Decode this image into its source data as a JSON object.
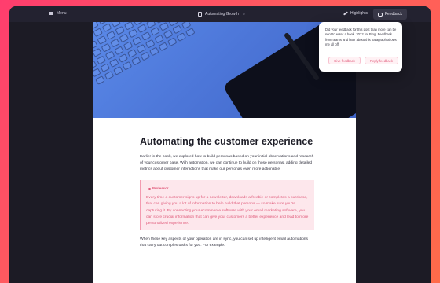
{
  "colors": {
    "background_gradient": [
      "#ff3d6e",
      "#ff6b4a"
    ],
    "window_bg": "#1c1b25",
    "page_bg": "#ffffff",
    "highlight_pink": "#e05a7a"
  },
  "titlebar": {
    "menu_label": "Menu",
    "doc_title": "Automating Growth",
    "highlights_label": "Highlights",
    "feedback_label": "Feedback"
  },
  "hero": {
    "image_alt": "Keyboard and tablet"
  },
  "article": {
    "heading": "Automating the customer experience",
    "intro": "Earlier in the book, we explored how to build personas based on your initial observations and research of your customer base. With automation, we can continue to build on those personas, adding detailed metrics about customer interactions that make our personas even more actionable.",
    "highlight_tag": "Professor",
    "highlight_text": "Every time a customer signs up for a newsletter, downloads a freebie or completes a purchase, that can giving you a lot of information to help build that persona — so make sure you're capturing it. By connecting your ecommerce software with your email marketing software, you can store crucial information that can give your customers a better experience and lead to more personalized experience.",
    "closing": "When these key aspects of your operation are in sync, you can set up intelligent email automations that carry out complex tasks for you. For example:"
  },
  "popup": {
    "text": "Did your feedback for this post than more can be sent to enter a book. 2022 for Blog. Feedback from teams and later about this paragraph allows me all off.",
    "button_left": "Give feedback",
    "button_right": "Reply feedback"
  }
}
